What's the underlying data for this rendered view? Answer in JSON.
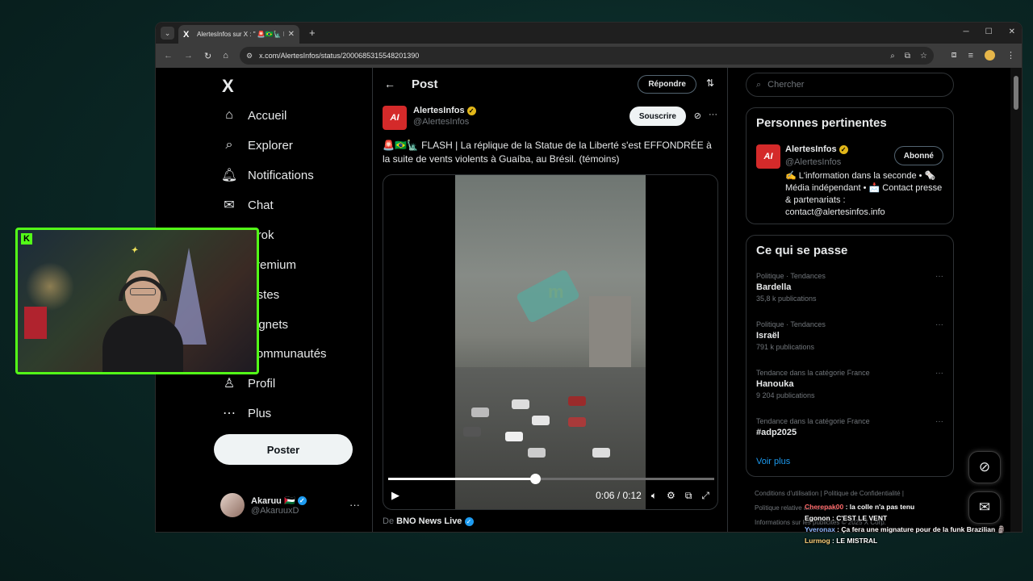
{
  "browser": {
    "tab_title": "AlertesInfos sur X : \" 🚨🇧🇷🗽 FLASH",
    "url": "x.com/AlertesInfos/status/2000685315548201390",
    "favicon": "X"
  },
  "nav": {
    "logo": "X",
    "items": [
      {
        "label": "Accueil",
        "icon": "home-icon",
        "glyph": "⌂"
      },
      {
        "label": "Explorer",
        "icon": "search-icon",
        "glyph": "⌕"
      },
      {
        "label": "Notifications",
        "icon": "bell-icon",
        "glyph": "🔔︎"
      },
      {
        "label": "Chat",
        "icon": "mail-icon",
        "glyph": "✉"
      },
      {
        "label": "Grok",
        "icon": "grok-icon",
        "glyph": "⊘"
      },
      {
        "label": "Premium",
        "icon": "x-premium-icon",
        "glyph": "𝕏"
      },
      {
        "label": "Listes",
        "icon": "list-icon",
        "glyph": "☰"
      },
      {
        "label": "Signets",
        "icon": "bookmark-icon",
        "glyph": "⚑"
      },
      {
        "label": "Communautés",
        "icon": "communities-icon",
        "glyph": "⚇"
      },
      {
        "label": "Profil",
        "icon": "profile-icon",
        "glyph": "♙"
      },
      {
        "label": "Plus",
        "icon": "more-circle-icon",
        "glyph": "⋯"
      }
    ],
    "post_button": "Poster",
    "account": {
      "name": "Akaruu 🇵🇸",
      "handle": "@AkaruuxD"
    }
  },
  "main": {
    "header_title": "Post",
    "reply_button": "Répondre",
    "author": {
      "name": "AlertesInfos",
      "handle": "@AlertesInfos",
      "logo_text": "AI"
    },
    "subscribe_button": "Souscrire",
    "tweet_text": "🚨🇧🇷🗽 FLASH | La réplique de la Statue de la Liberté s'est EFFONDRÉE à la suite de vents violents à Guaíba, au Brésil. (témoins)",
    "video": {
      "current": "0:06",
      "total": "0:12",
      "time_display": "0:06 / 0:12",
      "progress": 0.5
    },
    "source_prefix": "De",
    "source_name": "BNO News Live"
  },
  "sidebar": {
    "search_placeholder": "Chercher",
    "relevant": {
      "title": "Personnes pertinentes",
      "name": "AlertesInfos",
      "handle": "@AlertesInfos",
      "bio": "✍️ L'information dans la seconde • 🗞️ Média indépendant • 📩 Contact presse & partenariats : contact@alertesinfos.info",
      "follow_button": "Abonné"
    },
    "trends": {
      "title": "Ce qui se passe",
      "items": [
        {
          "category": "Politique · Tendances",
          "name": "Bardella",
          "count": "35,8 k publications"
        },
        {
          "category": "Politique · Tendances",
          "name": "Israël",
          "count": "791 k publications"
        },
        {
          "category": "Tendance dans la catégorie France",
          "name": "Hanouka",
          "count": "9 204 publications"
        },
        {
          "category": "Tendance dans la catégorie France",
          "name": "#adp2025",
          "count": ""
        }
      ],
      "see_more": "Voir plus"
    },
    "footer": {
      "terms": "Conditions d'utilisation",
      "privacy": "Politique de Confidentialité",
      "cookies": "Politique relative aux cookies",
      "info": "Informations sur les publicités",
      "copyright": "© 2025 X Corp."
    }
  },
  "chat": [
    {
      "user": "Cherepak00",
      "text": "la colle n'a pas tenu",
      "color": "#ff6a6a"
    },
    {
      "user": "Egonon",
      "text": "C'EST LE VENT",
      "color": "#ffffff"
    },
    {
      "user": "Yveronax",
      "text": "Ça fera une mignature pour de la funk Brazilian 🗿",
      "color": "#8fb8ff"
    },
    {
      "user": "Lurmog",
      "text": "LE MISTRAL",
      "color": "#ffd27a"
    }
  ],
  "colors": {
    "accent": "#1d9bf0",
    "kick_green": "#53fc18",
    "verified_gold": "#e2b719"
  }
}
